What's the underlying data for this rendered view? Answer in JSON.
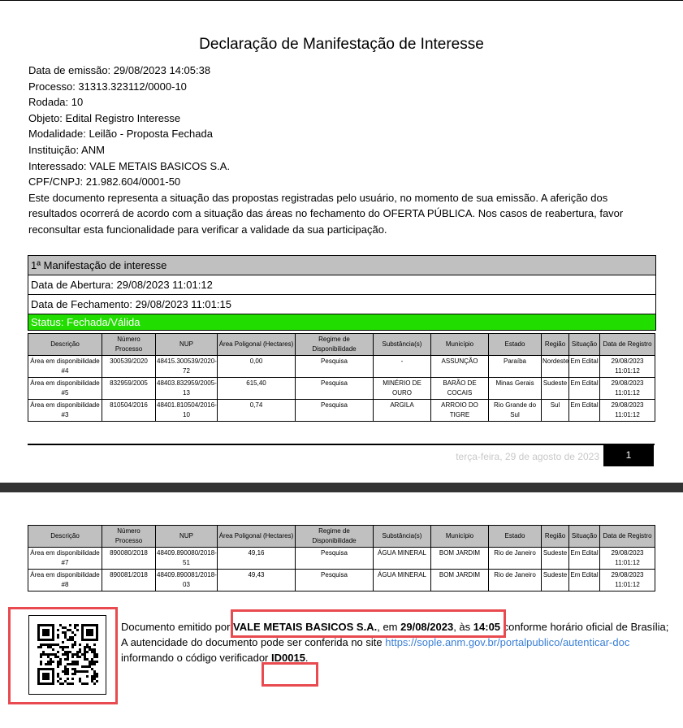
{
  "document": {
    "title": "Declaração de Manifestação de Interesse",
    "fields": [
      "Data de emissão: 29/08/2023 14:05:38",
      "Processo: 31313.323112/0000-10",
      "Rodada: 10",
      "Objeto: Edital Registro Interesse",
      "Modalidade: Leilão - Proposta Fechada",
      "Instituição: ANM",
      "Interessado: VALE METAIS BASICOS S.A.",
      "CPF/CNPJ: 21.982.604/0001-50"
    ],
    "notice": "Este documento representa a situação das propostas registradas pelo usuário, no momento de sua emissão. A aferição dos resultados ocorrerá de acordo com a situação das áreas no fechamento do OFERTA PÚBLICA. Nos casos de reabertura, favor reconsultar esta funcionalidade para verificar a validade da sua participação."
  },
  "manifestation": {
    "heading": "1ª Manifestação de interesse",
    "opened": "Data de Abertura: 29/08/2023 11:01:12",
    "closed": "Data de Fechamento: 29/08/2023 11:01:15",
    "status": "Status: Fechada/Válida",
    "status_color": "#22dd00"
  },
  "table": {
    "headers": [
      "Descrição",
      "Número Processo",
      "NUP",
      "Área Poligonal (Hectares)",
      "Regime de Disponibilidade",
      "Substância(s)",
      "Município",
      "Estado",
      "Região",
      "Situação",
      "Data de Registro"
    ],
    "rows_page1": [
      [
        "Área em disponibilidade #4",
        "300539/2020",
        "48415.300539/2020-72",
        "0,00",
        "Pesquisa",
        "-",
        "ASSUNÇÃO",
        "Paraíba",
        "Nordeste",
        "Em Edital",
        "29/08/2023 11:01:12"
      ],
      [
        "Área em disponibilidade #5",
        "832959/2005",
        "48403.832959/2005-13",
        "615,40",
        "Pesquisa",
        "MINÉRIO DE OURO",
        "BARÃO DE COCAIS",
        "Minas Gerais",
        "Sudeste",
        "Em Edital",
        "29/08/2023 11:01:12"
      ],
      [
        "Área em disponibilidade #3",
        "810504/2016",
        "48401.810504/2016-10",
        "0,74",
        "Pesquisa",
        "ARGILA",
        "ARROIO DO TIGRE",
        "Rio Grande do Sul",
        "Sul",
        "Em Edital",
        "29/08/2023 11:01:12"
      ]
    ],
    "rows_page2": [
      [
        "Área em disponibilidade #7",
        "890080/2018",
        "48409.890080/2018-51",
        "49,16",
        "Pesquisa",
        "ÁGUA MINERAL",
        "BOM JARDIM",
        "Rio de Janeiro",
        "Sudeste",
        "Em Edital",
        "29/08/2023 11:01:12"
      ],
      [
        "Área em disponibilidade #8",
        "890081/2018",
        "48409.890081/2018-03",
        "49,43",
        "Pesquisa",
        "ÁGUA MINERAL",
        "BOM JARDIM",
        "Rio de Janeiro",
        "Sudeste",
        "Em Edital",
        "29/08/2023 11:01:12"
      ]
    ]
  },
  "footer": {
    "date": "terça-feira, 29 de agosto de 2023",
    "page": "1"
  },
  "signature": {
    "t1": "Documento emitido por ",
    "company": "VALE METAIS BASICOS S.A.",
    "t2": ", em ",
    "date": "29/08/2023",
    "t3": ", às ",
    "time": "14:05",
    "t4": " conforme horário oficial de Brasília;",
    "t5": "A autencidade do documento pode ser conferida no site ",
    "url": "https://sople.anm.gov.br/portalpublico/autenticar-doc",
    "t6": "informando o código verificador ",
    "code": "ID0015",
    "t7": ".",
    "highlight_color": "#e84a4f",
    "link_color": "#3a7fd6"
  }
}
